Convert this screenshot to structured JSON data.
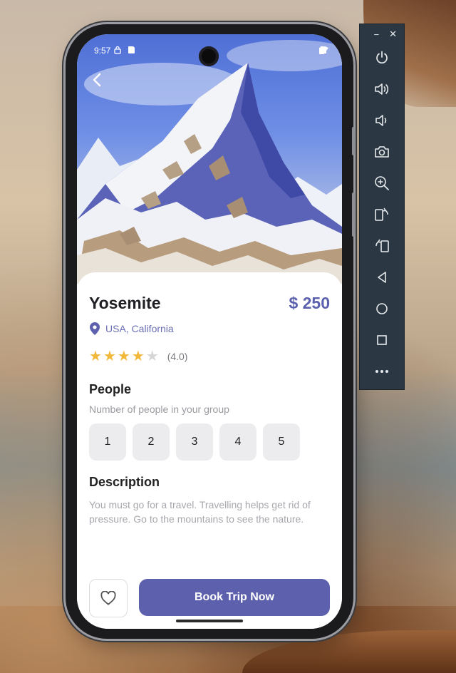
{
  "status_bar": {
    "time": "9:57"
  },
  "destination": {
    "title": "Yosemite",
    "price": "$ 250",
    "location": "USA, California",
    "rating": 4.0,
    "rating_label": "(4.0)",
    "stars": [
      true,
      true,
      true,
      true,
      false
    ]
  },
  "people": {
    "heading": "People",
    "subtitle": "Number of people in your group",
    "options": [
      "1",
      "2",
      "3",
      "4",
      "5"
    ]
  },
  "description": {
    "heading": "Description",
    "text": "You must go for a travel. Travelling helps get rid of pressure. Go to the mountains to see the nature."
  },
  "actions": {
    "book_label": "Book Trip Now"
  },
  "toolbar": {
    "minimize": "−",
    "close": "✕",
    "tools": [
      "power-icon",
      "volume-up-icon",
      "volume-down-icon",
      "camera-icon",
      "zoom-icon",
      "rotate-right-icon",
      "rotate-left-icon",
      "back-icon",
      "home-icon",
      "overview-icon",
      "more-icon"
    ]
  },
  "colors": {
    "accent": "#5d61ad",
    "star": "#f0b93a",
    "toolbar_bg": "#2b3843"
  }
}
